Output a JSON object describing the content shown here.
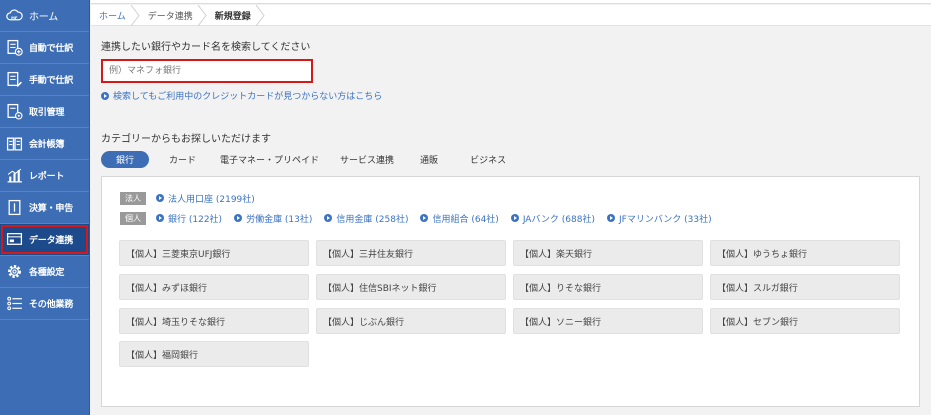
{
  "sidebar": {
    "home_label": "ホーム",
    "items": [
      {
        "label": "自動で仕訳",
        "icon": "auto-journal-icon"
      },
      {
        "label": "手動で仕訳",
        "icon": "manual-journal-icon"
      },
      {
        "label": "取引管理",
        "icon": "transaction-icon"
      },
      {
        "label": "会計帳簿",
        "icon": "ledger-book-icon"
      },
      {
        "label": "レポート",
        "icon": "report-chart-icon"
      },
      {
        "label": "決算・申告",
        "icon": "settlement-icon"
      },
      {
        "label": "データ連携",
        "icon": "data-link-icon",
        "active": true
      },
      {
        "label": "各種設定",
        "icon": "gear-icon"
      },
      {
        "label": "その他業務",
        "icon": "list-icon"
      }
    ]
  },
  "breadcrumb": [
    "ホーム",
    "データ連携",
    "新規登録"
  ],
  "search": {
    "title": "連携したい銀行やカード名を検索してください",
    "placeholder": "例）マネフォ銀行",
    "help_link": "検索してもご利用中のクレジットカードが見つからない方はこちら"
  },
  "category": {
    "title": "カテゴリーからもお探しいただけます",
    "tabs": [
      "銀行",
      "カード",
      "電子マネー・プリペイド",
      "サービス連携",
      "通販",
      "ビジネス"
    ]
  },
  "corp_row": {
    "tag": "法人",
    "links": [
      "法人用口座 (2199社)"
    ]
  },
  "personal_row": {
    "tag": "個人",
    "links": [
      "銀行 (122社)",
      "労働金庫 (13社)",
      "信用金庫 (258社)",
      "信用組合 (64社)",
      "JAバンク (688社)",
      "JFマリンバンク (33社)"
    ]
  },
  "banks": [
    "【個人】三菱東京UFJ銀行",
    "【個人】三井住友銀行",
    "【個人】楽天銀行",
    "【個人】ゆうちょ銀行",
    "【個人】みずほ銀行",
    "【個人】住信SBIネット銀行",
    "【個人】りそな銀行",
    "【個人】スルガ銀行",
    "【個人】埼玉りそな銀行",
    "【個人】じぶん銀行",
    "【個人】ソニー銀行",
    "【個人】セブン銀行",
    "【個人】福岡銀行"
  ],
  "colors": {
    "sidebar": "#3d6eb5",
    "accent_link": "#3b73c2",
    "highlight_red": "#d61818"
  }
}
